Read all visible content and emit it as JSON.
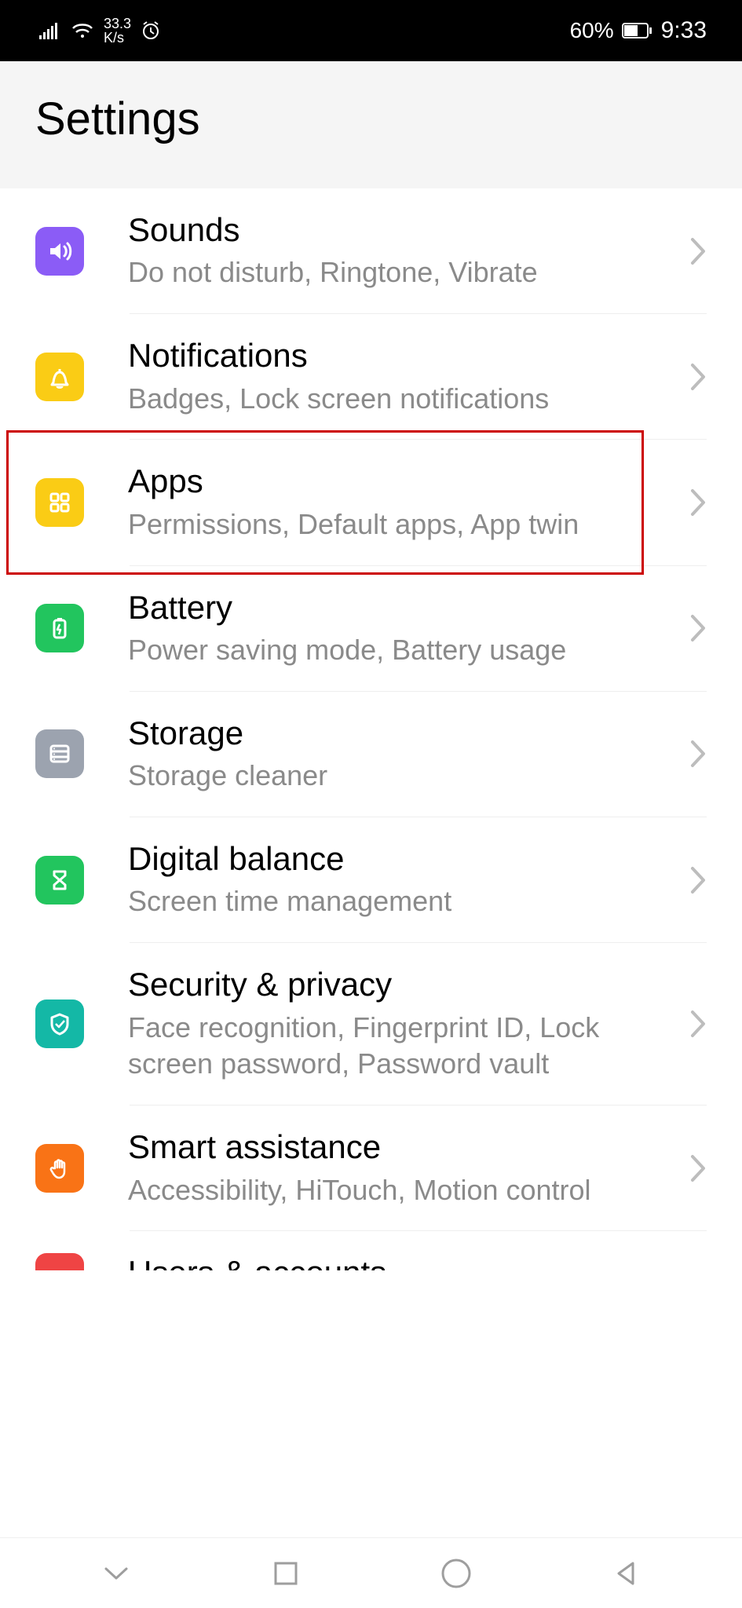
{
  "status": {
    "speed_top": "33.3",
    "speed_bottom": "K/s",
    "battery_percent": "60%",
    "time": "9:33"
  },
  "header": {
    "title": "Settings"
  },
  "items": [
    {
      "icon": "volume-icon",
      "color": "c-purple",
      "title": "Sounds",
      "subtitle": "Do not disturb, Ringtone, Vibrate"
    },
    {
      "icon": "bell-icon",
      "color": "c-yellow",
      "title": "Notifications",
      "subtitle": "Badges, Lock screen notifications"
    },
    {
      "icon": "apps-icon",
      "color": "c-yellow",
      "title": "Apps",
      "subtitle": "Permissions, Default apps, App twin",
      "highlighted": true
    },
    {
      "icon": "battery-icon",
      "color": "c-green",
      "title": "Battery",
      "subtitle": "Power saving mode, Battery usage"
    },
    {
      "icon": "storage-icon",
      "color": "c-grey",
      "title": "Storage",
      "subtitle": "Storage cleaner"
    },
    {
      "icon": "hourglass-icon",
      "color": "c-green",
      "title": "Digital balance",
      "subtitle": "Screen time management"
    },
    {
      "icon": "shield-icon",
      "color": "c-teal",
      "title": "Security & privacy",
      "subtitle": "Face recognition, Fingerprint ID, Lock screen password, Password vault"
    },
    {
      "icon": "hand-icon",
      "color": "c-orange",
      "title": "Smart assistance",
      "subtitle": "Accessibility, HiTouch, Motion control"
    }
  ],
  "partial_item": {
    "icon": "users-icon",
    "color": "c-red",
    "title": "Users & accounts"
  }
}
